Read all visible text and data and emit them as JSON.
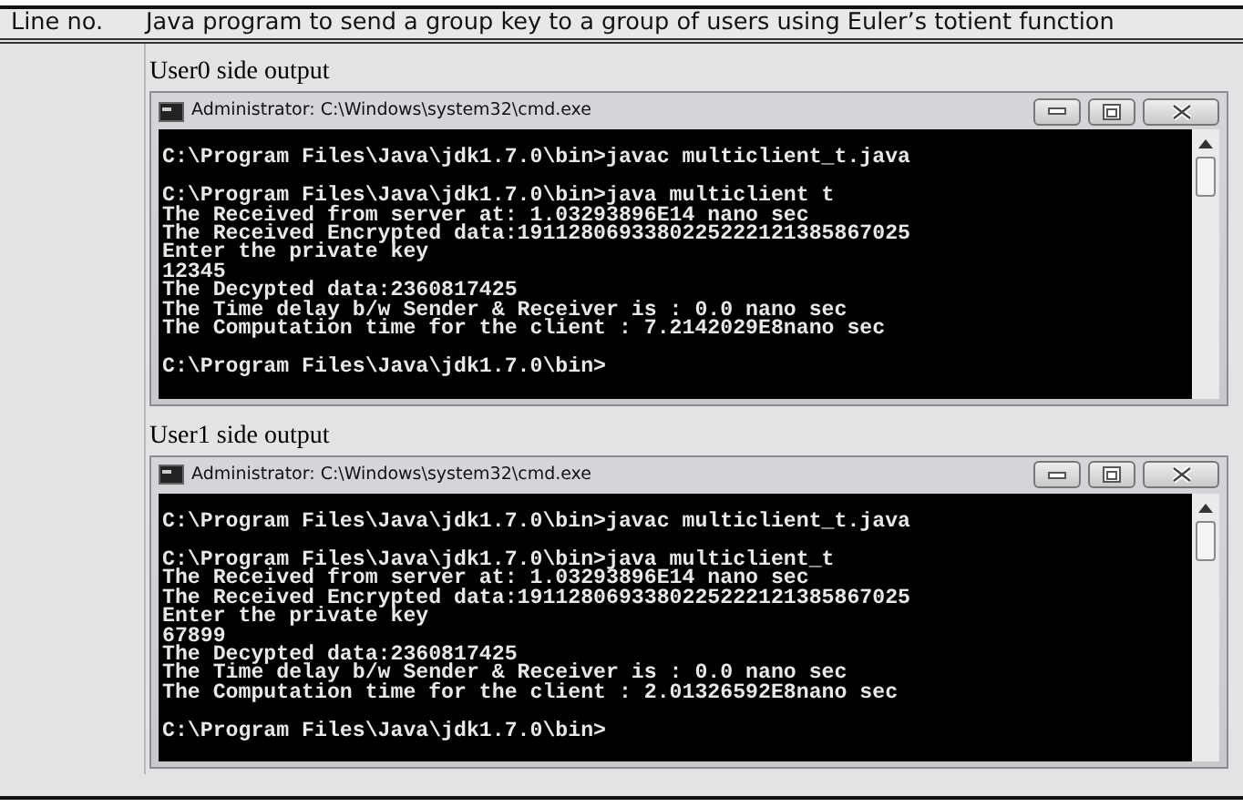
{
  "table": {
    "columns": [
      "Line no.",
      "Java program to send a group key to a group of users using Euler’s totient function"
    ],
    "outputs": [
      {
        "caption": "User0 side output",
        "window": {
          "title": "Administrator: C:\\Windows\\system32\\cmd.exe",
          "blocks": [
            [
              "C:\\Program Files\\Java\\jdk1.7.0\\bin>javac multiclient_t.java"
            ],
            [
              "C:\\Program Files\\Java\\jdk1.7.0\\bin>java multiclient t",
              "The Received from server at: 1.03293896E14 nano sec",
              "The Received Encrypted data:1911280693380225222121385867025",
              "Enter the private key",
              "12345",
              "The Decypted data:2360817425",
              "The Time delay b/w Sender & Receiver is : 0.0 nano sec",
              "The Computation time for the client : 7.2142029E8nano sec"
            ],
            [
              "C:\\Program Files\\Java\\jdk1.7.0\\bin>"
            ]
          ]
        }
      },
      {
        "caption": "User1 side output",
        "window": {
          "title": "Administrator: C:\\Windows\\system32\\cmd.exe",
          "blocks": [
            [
              "C:\\Program Files\\Java\\jdk1.7.0\\bin>javac multiclient_t.java"
            ],
            [
              "C:\\Program Files\\Java\\jdk1.7.0\\bin>java multiclient_t",
              "The Received from server at: 1.03293896E14 nano sec",
              "The Received Encrypted data:1911280693380225222121385867025",
              "Enter the private key",
              "67899",
              "The Decypted data:2360817425",
              "The Time delay b/w Sender & Receiver is : 0.0 nano sec",
              "The Computation time for the client : 2.01326592E8nano sec"
            ],
            [
              "C:\\Program Files\\Java\\jdk1.7.0\\bin>"
            ]
          ]
        }
      }
    ]
  }
}
